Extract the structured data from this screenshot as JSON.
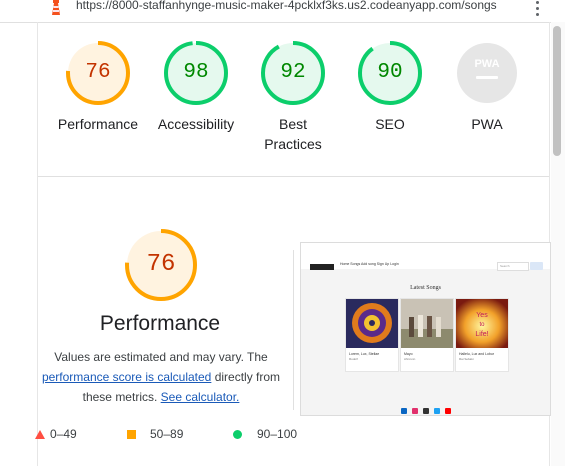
{
  "browser": {
    "url": "https://8000-staffanhynge-music-maker-4pcklxf3ks.us2.codeanyapp.com/songs"
  },
  "scores": [
    {
      "label": "Performance",
      "value": "76",
      "score": 0.76,
      "color": "#ffa400",
      "bg": "#fff3e0",
      "text_color": "#c33300"
    },
    {
      "label": "Accessibility",
      "value": "98",
      "score": 0.98,
      "color": "#0cce6b",
      "bg": "#e5f9ee",
      "text_color": "#008800"
    },
    {
      "label": "Best Practices",
      "value": "92",
      "score": 0.92,
      "color": "#0cce6b",
      "bg": "#e5f9ee",
      "text_color": "#008800"
    },
    {
      "label": "SEO",
      "value": "90",
      "score": 0.9,
      "color": "#0cce6b",
      "bg": "#e5f9ee",
      "text_color": "#008800"
    },
    {
      "label": "PWA",
      "value": "PWA",
      "score": null,
      "color": "#cccccc",
      "bg": "#e6e6e6",
      "text_color": "#ffffff"
    }
  ],
  "performance": {
    "score": "76",
    "title": "Performance",
    "desc_prefix": "Values are estimated and may vary. The ",
    "link_score": "performance score is calculated",
    "desc_middle": " directly from these metrics. ",
    "link_calc": "See calculator."
  },
  "legend": {
    "low": "0–49",
    "mid": "50–89",
    "high": "90–100"
  },
  "screenshot": {
    "nav_links": "Home  Songs  Add song  Sign Up  Login",
    "search_placeholder": "Search",
    "heading": "Latest Songs",
    "cards": [
      {
        "title": "Lorem, Lux, Stellae",
        "artist": "Rudolf"
      },
      {
        "title": "Mayo",
        "artist": "Ahnrunn"
      },
      {
        "title": "Hallelu, Lux and Lobur",
        "artist": "Rai Sebaki"
      }
    ],
    "yes_art_text": "Yes to Life!"
  }
}
